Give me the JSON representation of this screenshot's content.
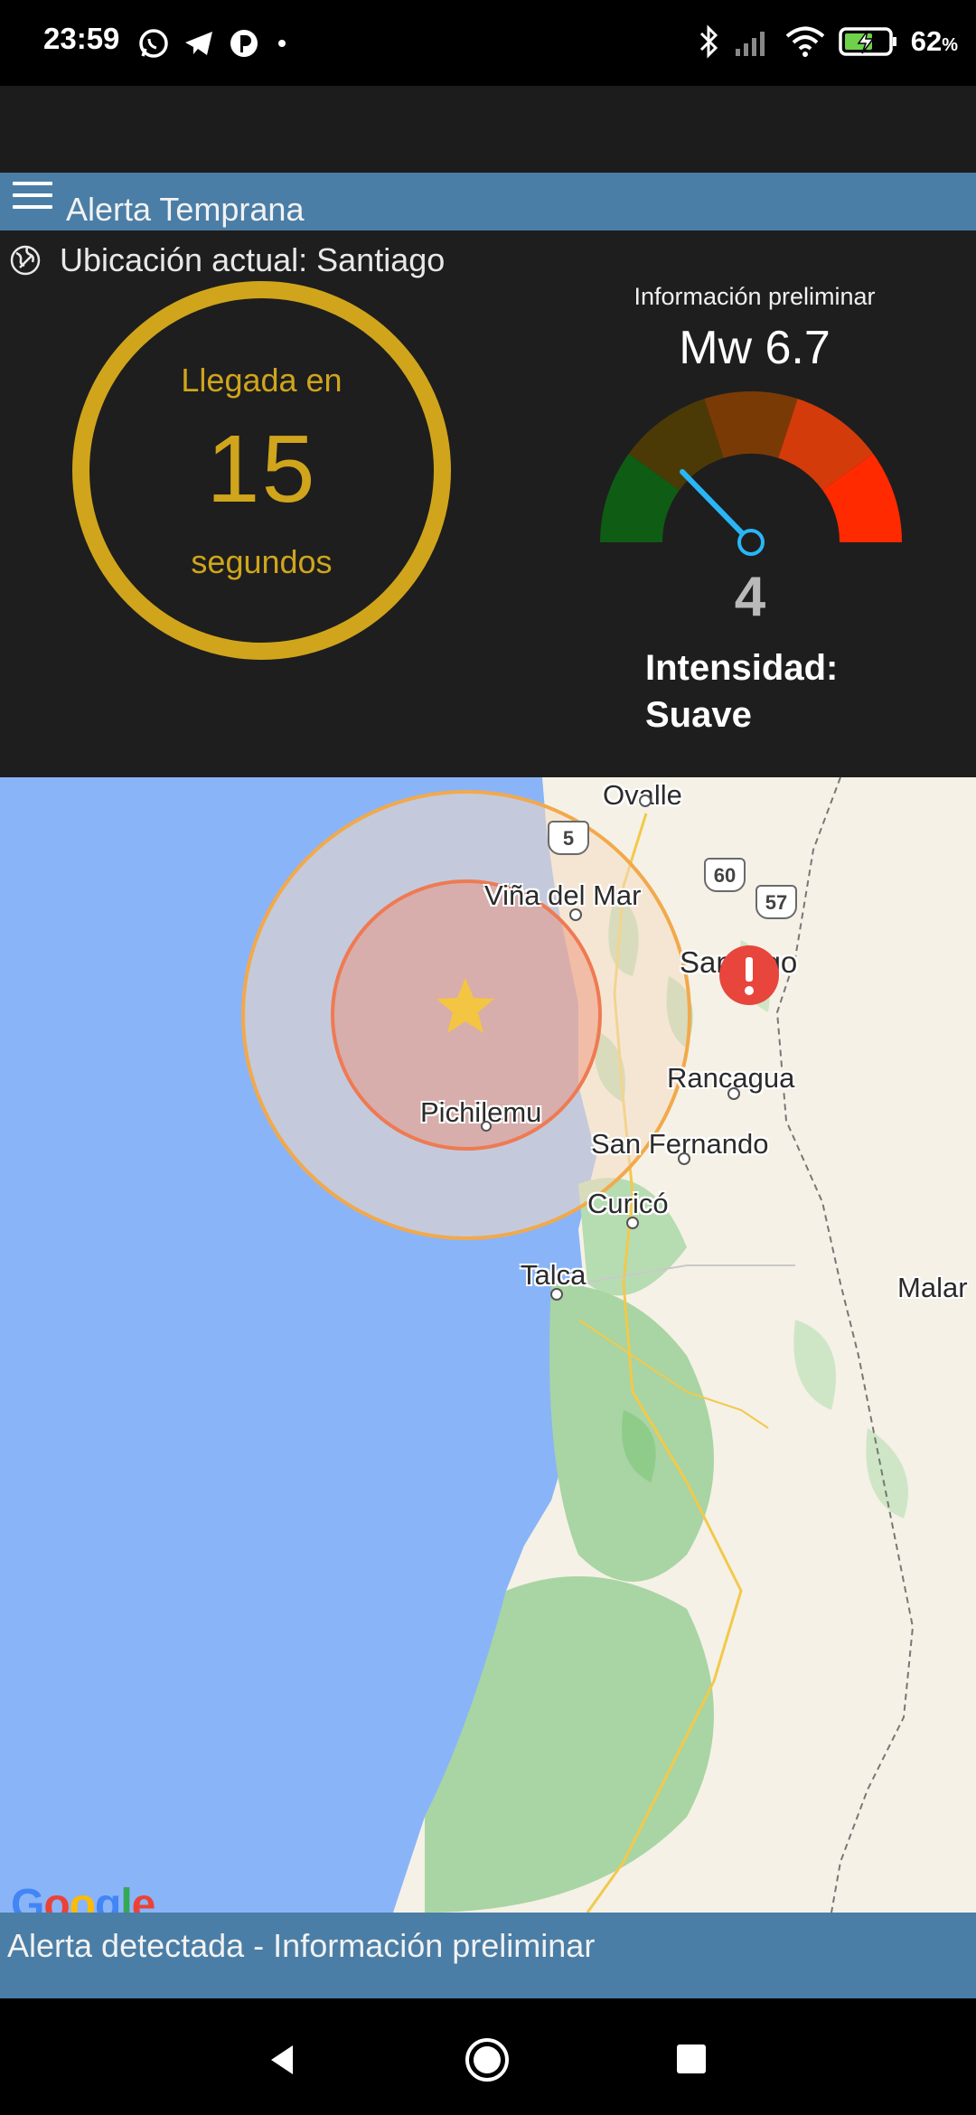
{
  "status_bar": {
    "time": "23:59",
    "battery_percent": "62",
    "battery_unit": "%",
    "left_icons": [
      "whatsapp-icon",
      "telegram-icon",
      "app-notification-icon",
      "dot-icon"
    ],
    "right_icons": [
      "bluetooth-icon",
      "signal-icon",
      "wifi-icon",
      "battery-charging-icon"
    ]
  },
  "header": {
    "title": "Alerta Temprana",
    "menu_icon": "menu-icon"
  },
  "location": {
    "icon": "globe-location-icon",
    "text": "Ubicación actual: Santiago"
  },
  "countdown": {
    "top_text": "Llegada en",
    "value": "15",
    "bottom_text": "segundos",
    "color": "#d0a51c"
  },
  "magnitude": {
    "preliminary_label": "Información preliminar",
    "value": "Mw 6.7"
  },
  "intensity": {
    "value": "4",
    "label": "Intensidad: Suave",
    "gauge_segments": [
      "#0f5c14",
      "#4c3a06",
      "#7a3a06",
      "#d33b0a",
      "#ff2a00"
    ],
    "needle_color": "#29b6f6"
  },
  "map": {
    "labels": {
      "ovalle": "Ovalle",
      "vina": "Viña del Mar",
      "santiago": "Santiago",
      "rancagua": "Rancagua",
      "pichilemu": "Pichilemu",
      "san_fernando": "San Fernando",
      "curico": "Curicó",
      "talca": "Talca",
      "malar": "Malar"
    },
    "highways": [
      "5",
      "60",
      "57"
    ],
    "attribution": "Google",
    "ocean_color": "#8ab4f8",
    "land_color": "#f5f1e6",
    "epicenter_icon": "star-icon",
    "alert_icon": "exclamation-icon"
  },
  "footer": {
    "text": "Alerta detectada - Información preliminar"
  },
  "nav_bar": {
    "back": "back-icon",
    "home": "home-icon",
    "recents": "recents-icon"
  }
}
